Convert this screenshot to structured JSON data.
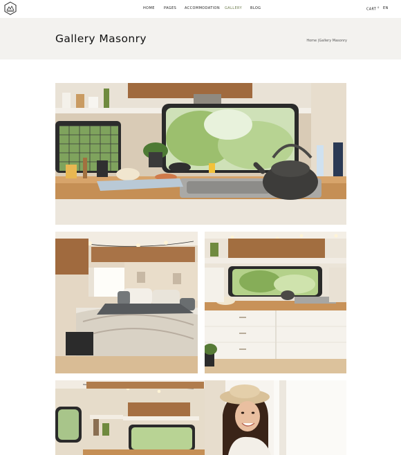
{
  "header": {
    "nav": [
      {
        "label": "HOME",
        "active": false
      },
      {
        "label": "PAGES",
        "active": false
      },
      {
        "label": "ACCOMMODATION",
        "active": false
      },
      {
        "label": "GALLERY",
        "active": true
      },
      {
        "label": "BLOG",
        "active": false
      }
    ],
    "cart_label": "CART",
    "cart_count": "0",
    "language": "EN"
  },
  "title_band": {
    "title": "Gallery Masonry",
    "breadcrumb_home": "Home",
    "breadcrumb_sep": "|",
    "breadcrumb_current": "Gallery Masonry"
  },
  "gallery": {
    "images": [
      {
        "subject": "camper van kitchen with kettle and window"
      },
      {
        "subject": "camper van bed with string lights"
      },
      {
        "subject": "camper van kitchen with white cabinets"
      },
      {
        "subject": "camper van interior with wooden cabinets"
      },
      {
        "subject": "woman in straw hat smiling in van"
      }
    ]
  },
  "colors": {
    "accent": "#6d7c4e",
    "band": "#f3f2ef",
    "wood": "#b98a57"
  }
}
